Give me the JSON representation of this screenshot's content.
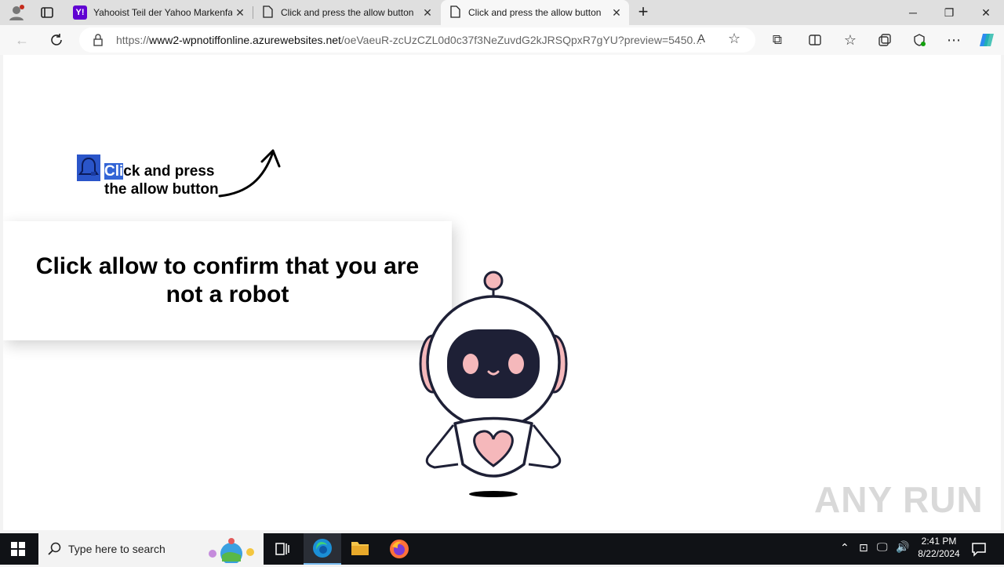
{
  "browser": {
    "tabs": [
      {
        "title": "Yahooist Teil der Yahoo Markenfa",
        "icon": "yahoo-icon"
      },
      {
        "title": "Click and press the allow button",
        "icon": "page-icon"
      },
      {
        "title": "Click and press the allow button",
        "icon": "page-icon"
      }
    ],
    "url_prefix": "https://",
    "url_domain": "www2-wpnotiffonline.azurewebsites.net",
    "url_path": "/oeVaeuR-zcUzCZL0d0c37f3NeZuvdG2kJRSQpxR7gYU?preview=5450..."
  },
  "page": {
    "hint_selected": "Cli",
    "hint_line1_rest": "ck and press",
    "hint_line2": "the allow button",
    "headline": "Click allow to confirm that you are not a robot",
    "watermark": "ANY RUN"
  },
  "taskbar": {
    "search_placeholder": "Type here to search",
    "time": "2:41 PM",
    "date": "8/22/2024"
  },
  "colors": {
    "accent": "#2a55c9",
    "robot_pink": "#f5b8bb",
    "robot_dark": "#1e2036"
  }
}
